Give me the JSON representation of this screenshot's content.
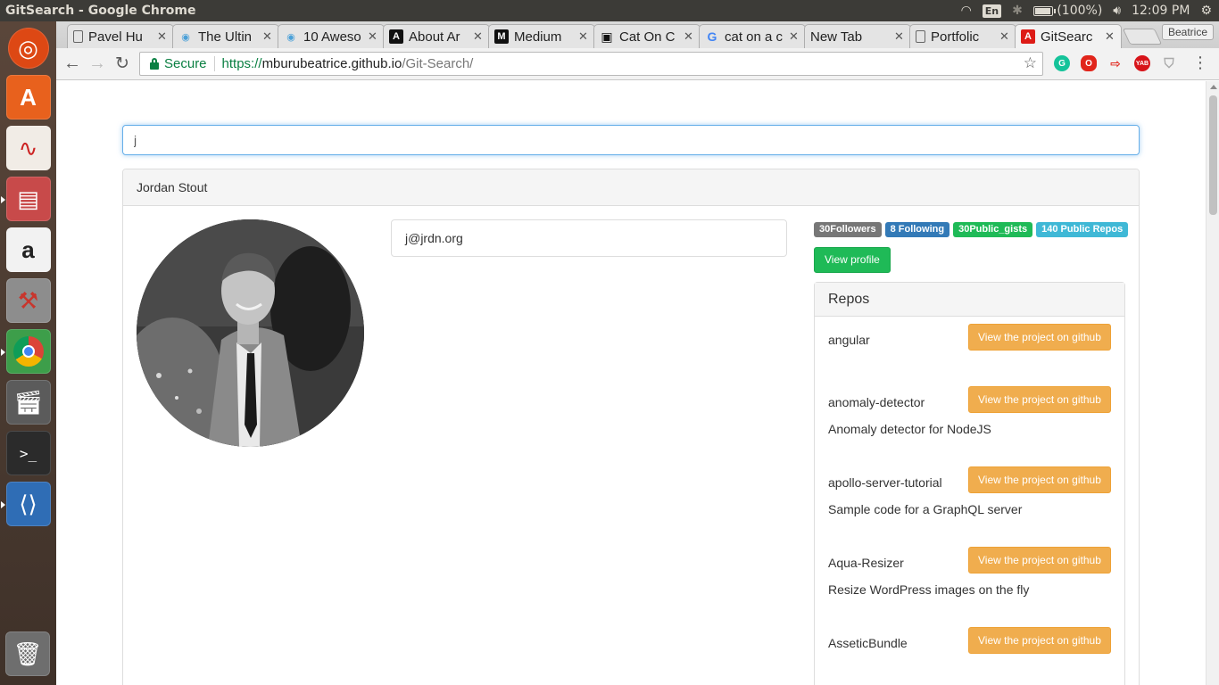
{
  "window": {
    "title": "GitSearch - Google Chrome"
  },
  "system": {
    "language": "En",
    "battery": "(100%)",
    "battery_level": 1.0,
    "clock": "12:09 PM"
  },
  "tabs": [
    {
      "label": "Pavel Hu",
      "favicon": "document-icon"
    },
    {
      "label": "The Ultin",
      "favicon": "eye-icon"
    },
    {
      "label": "10 Aweso",
      "favicon": "eye-icon"
    },
    {
      "label": "About Ar",
      "favicon": "angular-icon"
    },
    {
      "label": "Medium",
      "favicon": "medium-icon"
    },
    {
      "label": "Cat On C",
      "favicon": "camera-icon"
    },
    {
      "label": "cat on a c",
      "favicon": "google-icon"
    },
    {
      "label": "New Tab",
      "favicon": ""
    },
    {
      "label": "Portfolic",
      "favicon": "document-icon"
    },
    {
      "label": "GitSearc",
      "favicon": "angular-icon",
      "active": true
    }
  ],
  "profile": {
    "name": "Beatrice"
  },
  "omnibox": {
    "secure_label": "Secure",
    "url_scheme": "https://",
    "url_host": "mburubeatrice.github.io",
    "url_path": "/Git-Search/"
  },
  "page": {
    "search": {
      "value": "j",
      "placeholder": ""
    },
    "user": {
      "name": "Jordan Stout",
      "email": "j@jrdn.org",
      "followers_badge": "30Followers",
      "following_badge": "8 Following",
      "gists_badge": "30Public_gists",
      "repos_badge": "140 Public Repos",
      "view_profile_label": "View profile"
    },
    "repos": {
      "heading": "Repos",
      "button_label": "View the project on github",
      "items": [
        {
          "name": "angular",
          "description": ""
        },
        {
          "name": "anomaly-detector",
          "description": "Anomaly detector for NodeJS"
        },
        {
          "name": "apollo-server-tutorial",
          "description": "Sample code for a GraphQL server"
        },
        {
          "name": "Aqua-Resizer",
          "description": "Resize WordPress images on the fly"
        },
        {
          "name": "AsseticBundle",
          "description": ""
        }
      ]
    }
  },
  "colors": {
    "badge_followers": "#777777",
    "badge_following": "#337ab7",
    "badge_gists": "#1fba57",
    "badge_repos": "#3fb8d6",
    "btn_success": "#1fba57",
    "btn_warning": "#f0ad4e",
    "focus": "#66afe9"
  }
}
